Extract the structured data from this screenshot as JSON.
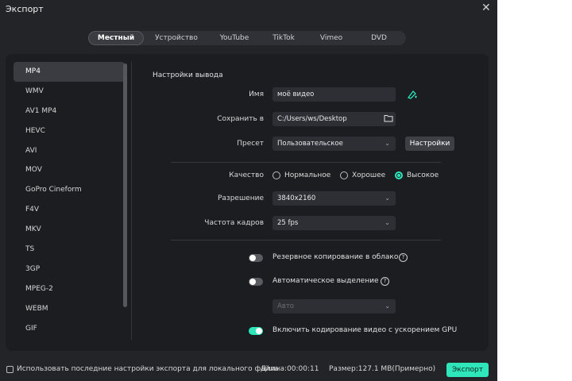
{
  "window": {
    "title": "Экспорт",
    "close_glyph": "✕"
  },
  "tabs": [
    {
      "label": "Местный",
      "active": true
    },
    {
      "label": "Устройство"
    },
    {
      "label": "YouTube"
    },
    {
      "label": "TikTok"
    },
    {
      "label": "Vimeo"
    },
    {
      "label": "DVD"
    }
  ],
  "formats": [
    "MP4",
    "WMV",
    "AV1 MP4",
    "HEVC",
    "AVI",
    "MOV",
    "GoPro Cineform",
    "F4V",
    "MKV",
    "TS",
    "3GP",
    "MPEG-2",
    "WEBM",
    "GIF"
  ],
  "selected_format": "MP4",
  "output": {
    "section_title": "Настройки вывода",
    "name_label": "Имя",
    "name_value": "моё видео",
    "save_label": "Сохранить в",
    "save_value": "C:/Users/ws/Desktop",
    "preset_label": "Пресет",
    "preset_value": "Пользовательское",
    "settings_button": "Настройки",
    "quality_label": "Качество",
    "quality_options": [
      "Нормальное",
      "Хорошее",
      "Высокое"
    ],
    "quality_selected": "Высокое",
    "resolution_label": "Разрешение",
    "resolution_value": "3840x2160",
    "fps_label": "Частота кадров",
    "fps_value": "25 fps",
    "backup_label": "Резервное копирование в облако",
    "backup_on": false,
    "auto_highlight_label": "Автоматическое выделение",
    "auto_highlight_on": false,
    "auto_value": "Авто",
    "gpu_label": "Включить кодирование видео с ускорением GPU",
    "gpu_on": true
  },
  "footer": {
    "use_last_label": "Использовать последние настройки экспорта для локального файла",
    "duration": "Длина:00:00:11",
    "size": "Размер:127.1 MB(Примерно)",
    "export_button": "Экспорт"
  },
  "colors": {
    "accent": "#2ee6b9",
    "window_bg": "#232428",
    "panel_bg": "#1c1d21"
  },
  "icons": [
    "close-icon",
    "ai-rename-icon",
    "folder-icon",
    "chevron-down-icon",
    "help-icon"
  ]
}
